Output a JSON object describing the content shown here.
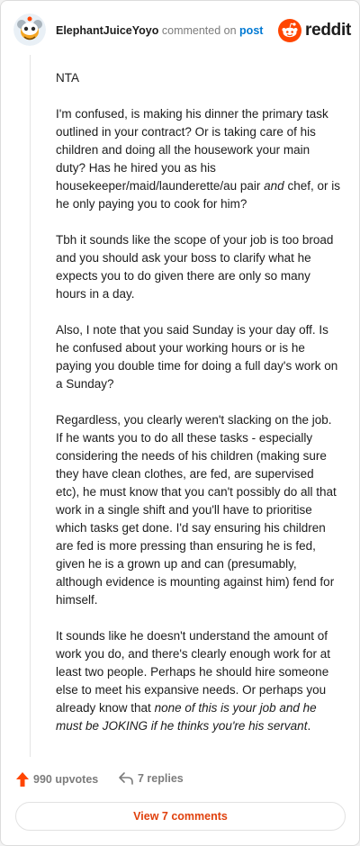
{
  "comment": {
    "username": "ElephantJuiceYoyo",
    "verb": "commented on",
    "post_link": "post",
    "brand": "reddit",
    "paragraphs": [
      [
        {
          "t": "NTA"
        }
      ],
      [
        {
          "t": "I'm confused, is making his dinner the primary task outlined in your contract? Or is taking care of his children and doing all the housework your main duty? Has he hired you as his housekeeper/maid/launderette/au pair "
        },
        {
          "t": "and",
          "em": true
        },
        {
          "t": " chef, or is he only paying you to cook for him?"
        }
      ],
      [
        {
          "t": "Tbh it sounds like the scope of your job is too broad and you should ask your boss to clarify what he expects you to do given there are only so many hours in a day."
        }
      ],
      [
        {
          "t": "Also, I note that you said Sunday is your day off. Is he confused about your working hours or is he paying you double time for doing a full day's work on a Sunday?"
        }
      ],
      [
        {
          "t": "Regardless, you clearly weren't slacking on the job. If he wants you to do all these tasks - especially considering the needs of his children (making sure they have clean clothes, are fed, are supervised etc), he must know that you can't possibly do all that work in a single shift and you'll have to prioritise which tasks get done. I'd say ensuring his children are fed is more pressing than ensuring he is fed, given he is a grown up and can (presumably, although evidence is mounting against him) fend for himself."
        }
      ],
      [
        {
          "t": "It sounds like he doesn't understand the amount of work you do, and there's clearly enough work for at least two people. Perhaps he should hire someone else to meet his expansive needs. Or perhaps you already know that "
        },
        {
          "t": "none of this is your job and he must be JOKING if he thinks you're his servant",
          "em": true
        },
        {
          "t": "."
        }
      ]
    ],
    "upvotes_label": "990 upvotes",
    "replies_label": "7 replies",
    "view_comments_label": "View 7 comments"
  },
  "colors": {
    "reddit_orange": "#ff4500",
    "link_blue": "#0079d3",
    "muted": "#7c7c7c"
  },
  "icons": {
    "avatar": "snoo-avatar-icon",
    "brand": "reddit-logo-icon",
    "upvote": "upvote-arrow-icon",
    "reply": "reply-arrow-icon"
  }
}
